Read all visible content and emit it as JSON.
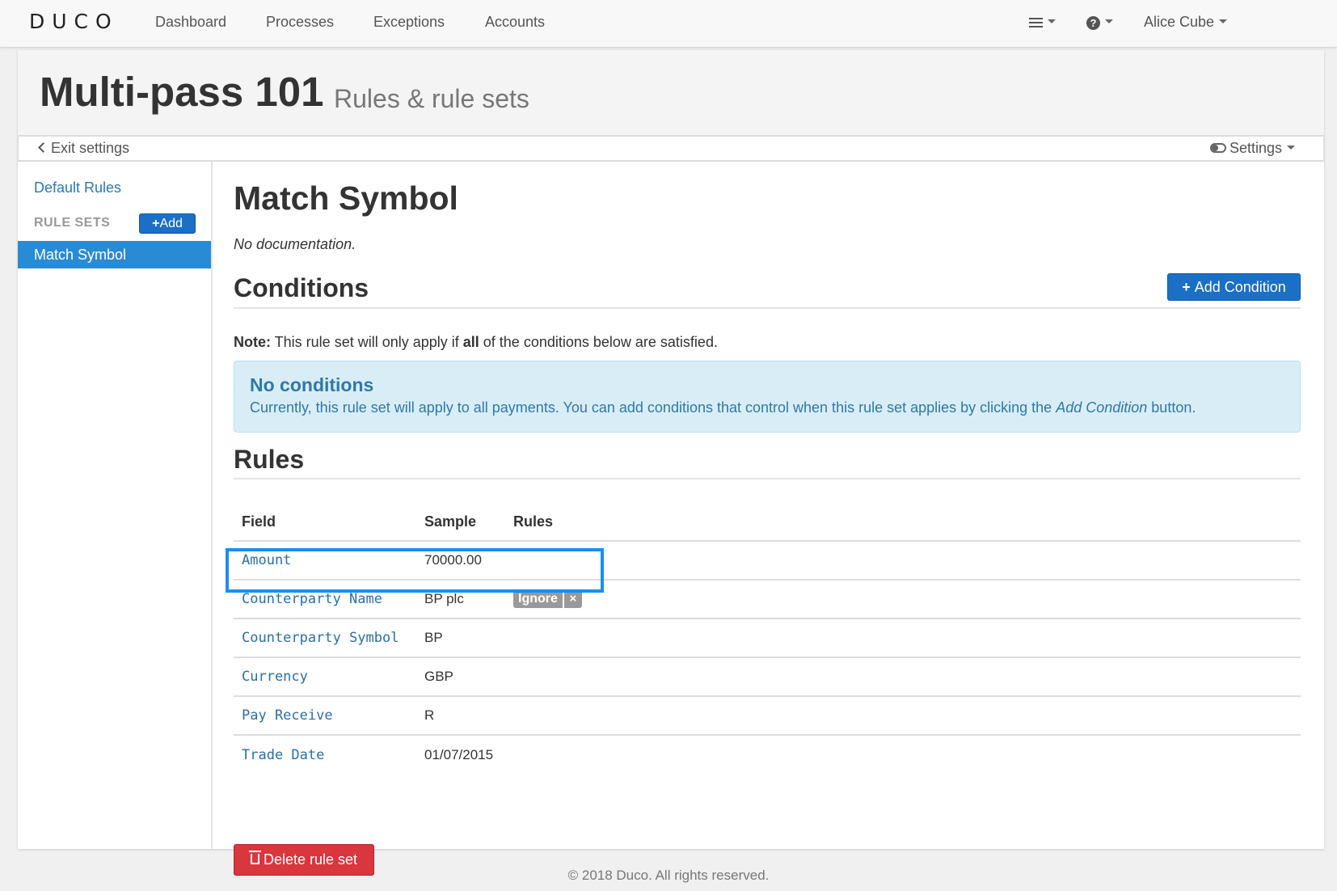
{
  "navbar": {
    "logo": "DUCO",
    "links": [
      "Dashboard",
      "Processes",
      "Exceptions",
      "Accounts"
    ],
    "user": "Alice Cube",
    "menu_icon": "hamburger-icon",
    "help_icon": "question-circle-icon"
  },
  "header": {
    "title": "Multi-pass 101",
    "subtitle": "Rules & rule sets"
  },
  "settings_bar": {
    "exit": "Exit settings",
    "settings": "Settings"
  },
  "sidebar": {
    "default_rules": "Default Rules",
    "section": "RULE SETS",
    "add_button": "Add",
    "active_item": "Match Symbol"
  },
  "main": {
    "title": "Match Symbol",
    "documentation": "No documentation.",
    "conditions": {
      "heading": "Conditions",
      "add_button": "Add Condition",
      "note_label": "Note:",
      "note_pre": " This rule set will only apply if ",
      "note_bold": "all",
      "note_post": " of the conditions below are satisfied.",
      "info_title": "No conditions",
      "info_pre": "Currently, this rule set will apply to all payments. You can add conditions that control when this rule set applies by clicking the ",
      "info_em": "Add Condition",
      "info_post": " button."
    },
    "rules": {
      "heading": "Rules",
      "columns": [
        "Field",
        "Sample",
        "Rules"
      ],
      "rows": [
        {
          "field": "Amount",
          "sample": "70000.00",
          "rule": ""
        },
        {
          "field": "Counterparty Name",
          "sample": "BP plc",
          "rule": "Ignore"
        },
        {
          "field": "Counterparty Symbol",
          "sample": "BP",
          "rule": ""
        },
        {
          "field": "Currency",
          "sample": "GBP",
          "rule": ""
        },
        {
          "field": "Pay Receive",
          "sample": "R",
          "rule": ""
        },
        {
          "field": "Trade Date",
          "sample": "01/07/2015",
          "rule": ""
        }
      ],
      "tag_remove": "×"
    },
    "delete_button": "Delete rule set"
  },
  "footer": "© 2018 Duco. All rights reserved.",
  "colors": {
    "primary": "#1b6fc5",
    "active_sidebar": "#2a8bd5",
    "info_bg": "#d9edf7",
    "danger": "#d9363e",
    "highlight": "#1c8df2"
  }
}
